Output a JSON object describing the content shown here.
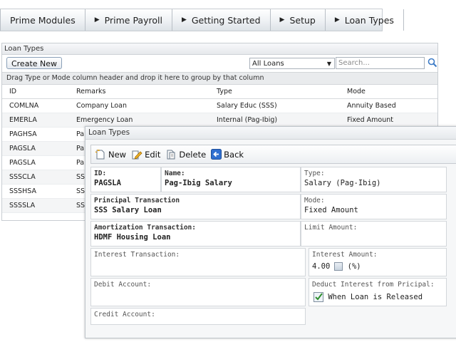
{
  "topnav": {
    "items": [
      {
        "label": "Prime Modules",
        "arrow": false
      },
      {
        "label": "Prime Payroll",
        "arrow": true
      },
      {
        "label": "Getting Started",
        "arrow": true
      },
      {
        "label": "Setup",
        "arrow": true
      },
      {
        "label": "Loan Types",
        "arrow": true
      }
    ]
  },
  "list_window": {
    "title": "Loan Types",
    "create_label": "Create New",
    "filter_value": "All Loans",
    "search_placeholder": "Search...",
    "group_hint": "Drag Type or Mode column header and drop it here to group by that column",
    "columns": [
      "ID",
      "Remarks",
      "Type",
      "Mode"
    ],
    "rows": [
      {
        "id": "COMLNA",
        "remarks": "Company Loan",
        "type": "Salary Educ (SSS)",
        "mode": "Annuity Based"
      },
      {
        "id": "EMERLA",
        "remarks": "Emergency Loan",
        "type": "Internal (Pag-Ibig)",
        "mode": "Fixed Amount"
      },
      {
        "id": "PAGHSA",
        "remarks": "Pa",
        "type": "",
        "mode": ""
      },
      {
        "id": "PAGSLA",
        "remarks": "Pa",
        "type": "",
        "mode": ""
      },
      {
        "id": "PAGSLA",
        "remarks": "Pa",
        "type": "",
        "mode": ""
      },
      {
        "id": "SSSCLA",
        "remarks": "SS",
        "type": "",
        "mode": ""
      },
      {
        "id": "SSSHSA",
        "remarks": "SS",
        "type": "",
        "mode": ""
      },
      {
        "id": "SSSSLA",
        "remarks": "SS",
        "type": "",
        "mode": ""
      }
    ]
  },
  "detail_window": {
    "title": "Loan Types",
    "toolbar": {
      "new": "New",
      "edit": "Edit",
      "delete": "Delete",
      "back": "Back"
    },
    "id_label": "ID:",
    "id_value": "PAGSLA",
    "name_label": "Name:",
    "name_value": "Pag-Ibig Salary",
    "type_label": "Type:",
    "type_value": "Salary (Pag-Ibig)",
    "principal_label": "Principal Transaction",
    "principal_value": "SSS Salary Loan",
    "mode_label": "Mode:",
    "mode_value": "Fixed Amount",
    "amort_label": "Amortization Transaction:",
    "amort_value": "HDMF Housing Loan",
    "limit_label": "Limit Amount:",
    "interest_txn_label": "Interest Transaction:",
    "interest_amt_label": "Interest Amount:",
    "interest_amt_value": "4.00",
    "percent_label": "(%)",
    "debit_label": "Debit Account:",
    "deduct_label": "Deduct Interest from Pricipal:",
    "deduct_value": "When Loan is Released",
    "credit_label": "Credit Account:"
  }
}
